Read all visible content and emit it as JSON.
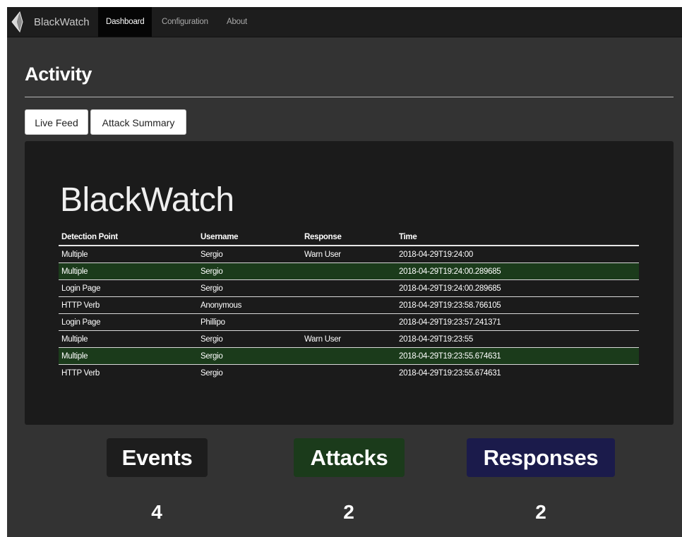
{
  "navbar": {
    "brand": "BlackWatch",
    "items": [
      {
        "label": "Dashboard",
        "active": true
      },
      {
        "label": "Configuration",
        "active": false
      },
      {
        "label": "About",
        "active": false
      }
    ]
  },
  "page": {
    "title": "Activity",
    "tabs": [
      {
        "label": "Live Feed"
      },
      {
        "label": "Attack Summary"
      }
    ]
  },
  "feed": {
    "title": "BlackWatch",
    "columns": [
      "Detection Point",
      "Username",
      "Response",
      "Time"
    ],
    "rows": [
      {
        "kind": "response",
        "detection_point": "Multiple",
        "username": "Sergio",
        "response": "Warn User",
        "time": "2018-04-29T19:24:00"
      },
      {
        "kind": "attack",
        "detection_point": "Multiple",
        "username": "Sergio",
        "response": "",
        "time": "2018-04-29T19:24:00.289685"
      },
      {
        "kind": "event",
        "detection_point": "Login Page",
        "username": "Sergio",
        "response": "",
        "time": "2018-04-29T19:24:00.289685"
      },
      {
        "kind": "event",
        "detection_point": "HTTP Verb",
        "username": "Anonymous",
        "response": "",
        "time": "2018-04-29T19:23:58.766105"
      },
      {
        "kind": "event",
        "detection_point": "Login Page",
        "username": "Phillipo",
        "response": "",
        "time": "2018-04-29T19:23:57.241371"
      },
      {
        "kind": "response",
        "detection_point": "Multiple",
        "username": "Sergio",
        "response": "Warn User",
        "time": "2018-04-29T19:23:55"
      },
      {
        "kind": "attack",
        "detection_point": "Multiple",
        "username": "Sergio",
        "response": "",
        "time": "2018-04-29T19:23:55.674631"
      },
      {
        "kind": "event",
        "detection_point": "HTTP Verb",
        "username": "Sergio",
        "response": "",
        "time": "2018-04-29T19:23:55.674631"
      }
    ]
  },
  "summary": {
    "events": {
      "label": "Events",
      "count": "4",
      "color": "#1d1d1d"
    },
    "attacks": {
      "label": "Attacks",
      "count": "2",
      "color": "#1b3b1b"
    },
    "responses": {
      "label": "Responses",
      "count": "2",
      "color": "#1b1b4b"
    }
  },
  "colors": {
    "navbar": "#1d1d1d",
    "page_background": "#333333",
    "panel_background": "#1b1b1b",
    "response_row": "#1b1b4b",
    "attack_row": "#1b3b1b"
  },
  "icons": {
    "brand": "blackwatch-logo-icon"
  }
}
